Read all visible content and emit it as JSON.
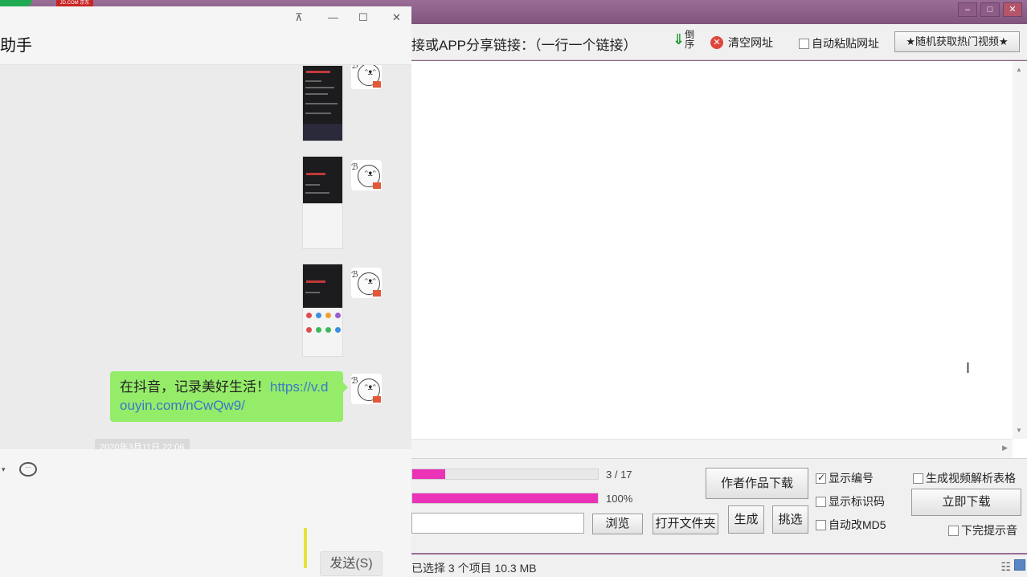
{
  "background_app": {
    "jd_tag": "JD.COM 京东",
    "toolbar": {
      "link_label": "接或APP分享链接：（一行一个链接）",
      "reverse_label": "倒序",
      "clear_label": "清空网址",
      "auto_paste_label": "自动粘贴网址",
      "random_button": "★随机获取热门视频★"
    },
    "progress": {
      "count_text": "3 / 17",
      "count_fraction": 0.176,
      "percent_text": "100%",
      "percent_fraction": 1.0
    },
    "buttons": {
      "browse": "浏览",
      "open_folder": "打开文件夹",
      "author_works": "作者作品下载",
      "generate": "生成",
      "pick": "挑选",
      "download_now": "立即下载"
    },
    "options": {
      "show_number": "显示编号",
      "show_id_code": "显示标识码",
      "auto_md5": "自动改MD5",
      "gen_table": "生成视频解析表格",
      "done_sound": "下完提示音"
    },
    "status_text": "已选择 3 个项目  10.3 MB",
    "colors": {
      "progress_fill": "#ea33b6",
      "titlebar": "#9a6d96"
    }
  },
  "wechat": {
    "title": "助手",
    "message": {
      "text": "在抖音，记录美好生活！",
      "link": "https://v.douyin.com/nCwQw9/"
    },
    "timestamp": "2020年3月11日 22:06",
    "send_button": "发送(S)",
    "colors": {
      "bubble": "#95ec69",
      "link": "#3a78c9"
    }
  }
}
